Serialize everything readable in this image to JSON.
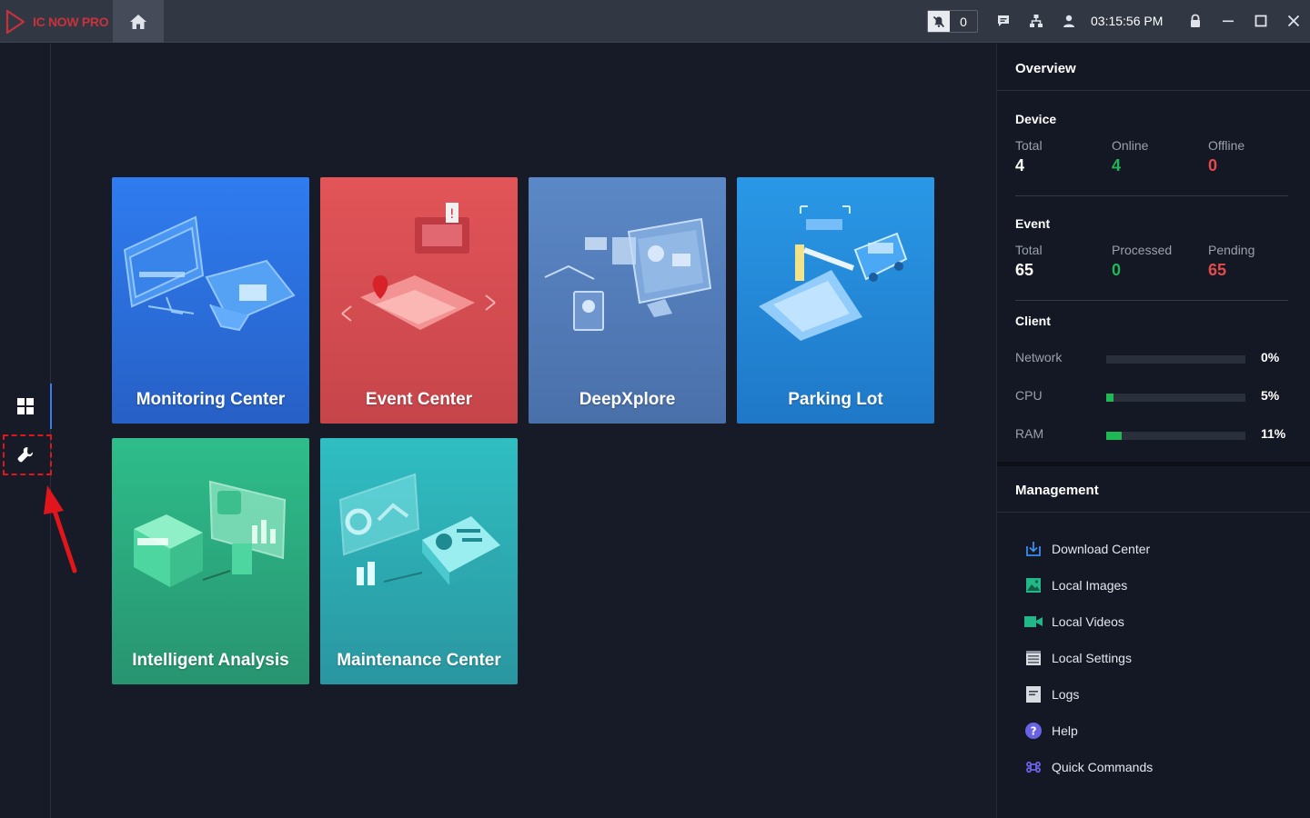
{
  "app": {
    "logo_text": "IC NOW PRO"
  },
  "topbar": {
    "alarm_count": "0",
    "time": "03:15:56 PM"
  },
  "tiles": [
    {
      "label": "Monitoring Center",
      "color_top": "#2f7cf0",
      "color_bottom": "#2860c8"
    },
    {
      "label": "Event Center",
      "color_top": "#e25458",
      "color_bottom": "#c9464c"
    },
    {
      "label": "DeepXplore",
      "color_top": "#5b86c4",
      "color_bottom": "#4a6fa8"
    },
    {
      "label": "Parking Lot",
      "color_top": "#2996e4",
      "color_bottom": "#1f7ac8"
    },
    {
      "label": "Intelligent Analysis",
      "color_top": "#2cbb8a",
      "color_bottom": "#2a9670"
    },
    {
      "label": "Maintenance Center",
      "color_top": "#2fbbc0",
      "color_bottom": "#2a98a0"
    }
  ],
  "overview": {
    "title": "Overview",
    "device": {
      "title": "Device",
      "total_label": "Total",
      "total_value": "4",
      "online_label": "Online",
      "online_value": "4",
      "offline_label": "Offline",
      "offline_value": "0"
    },
    "event": {
      "title": "Event",
      "total_label": "Total",
      "total_value": "65",
      "processed_label": "Processed",
      "processed_value": "0",
      "pending_label": "Pending",
      "pending_value": "65"
    },
    "client": {
      "title": "Client",
      "metrics": [
        {
          "label": "Network",
          "value": "0%",
          "fraction": 0.0
        },
        {
          "label": "CPU",
          "value": "5%",
          "fraction": 0.05
        },
        {
          "label": "RAM",
          "value": "11%",
          "fraction": 0.11
        }
      ]
    }
  },
  "management": {
    "title": "Management",
    "items": [
      {
        "label": "Download Center",
        "icon": "download-icon"
      },
      {
        "label": "Local Images",
        "icon": "image-icon"
      },
      {
        "label": "Local Videos",
        "icon": "video-camera-icon"
      },
      {
        "label": "Local Settings",
        "icon": "settings-window-icon"
      },
      {
        "label": "Logs",
        "icon": "log-document-icon"
      },
      {
        "label": "Help",
        "icon": "help-icon"
      },
      {
        "label": "Quick Commands",
        "icon": "command-key-icon"
      }
    ]
  },
  "colors": {
    "online": "#1eb955",
    "alert": "#e64b4b",
    "accent": "#3a7bf0"
  }
}
